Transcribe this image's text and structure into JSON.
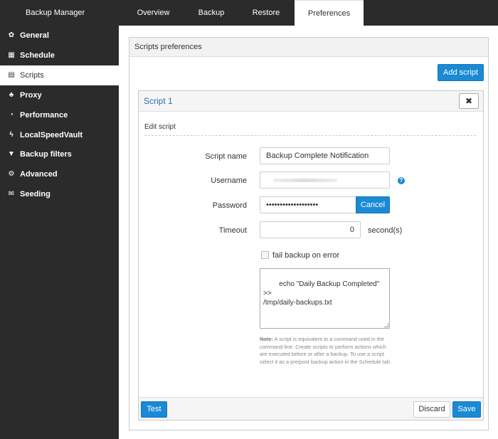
{
  "app": {
    "title": "Backup Manager"
  },
  "tabs": [
    {
      "label": "Overview"
    },
    {
      "label": "Backup"
    },
    {
      "label": "Restore"
    },
    {
      "label": "Preferences",
      "active": true
    }
  ],
  "sidebar": {
    "items": [
      {
        "label": "General",
        "icon": "gear-icon"
      },
      {
        "label": "Schedule",
        "icon": "calendar-icon"
      },
      {
        "label": "Scripts",
        "icon": "document-icon",
        "active": true
      },
      {
        "label": "Proxy",
        "icon": "network-icon"
      },
      {
        "label": "Performance",
        "icon": "dashboard-icon"
      },
      {
        "label": "LocalSpeedVault",
        "icon": "bolt-icon"
      },
      {
        "label": "Backup filters",
        "icon": "filter-icon"
      },
      {
        "label": "Advanced",
        "icon": "gears-icon"
      },
      {
        "label": "Seeding",
        "icon": "envelope-icon"
      }
    ]
  },
  "panel": {
    "header": "Scripts preferences",
    "add_script_label": "Add script"
  },
  "script": {
    "title": "Script 1",
    "close_label": "✖",
    "edit_label": "Edit script",
    "name_label": "Script name",
    "name_value": "Backup Complete Notification",
    "username_label": "Username",
    "username_value": "",
    "help_label": "?",
    "password_label": "Password",
    "password_value": "•••••••••••••••••••",
    "cancel_label": "Cancel",
    "timeout_label": "Timeout",
    "timeout_value": "0",
    "timeout_unit": "second(s)",
    "fail_label": "fail backup on error",
    "fail_checked": false,
    "script_body": "echo \"Daily Backup Completed\" >>\n/tmp/daily-backups.txt",
    "note_bold": "Note:",
    "note_text": " A script is equivalent to a command used in the command line. Create scripts to perform actions which are executed before or after a backup. To use a script select it as a pre/post backup action in the Schedule tab."
  },
  "footer": {
    "test_label": "Test",
    "discard_label": "Discard",
    "save_label": "Save"
  },
  "colors": {
    "sidebar_bg": "#2b2b2b",
    "accent": "#1a8ad4",
    "link": "#2a6fb1"
  }
}
